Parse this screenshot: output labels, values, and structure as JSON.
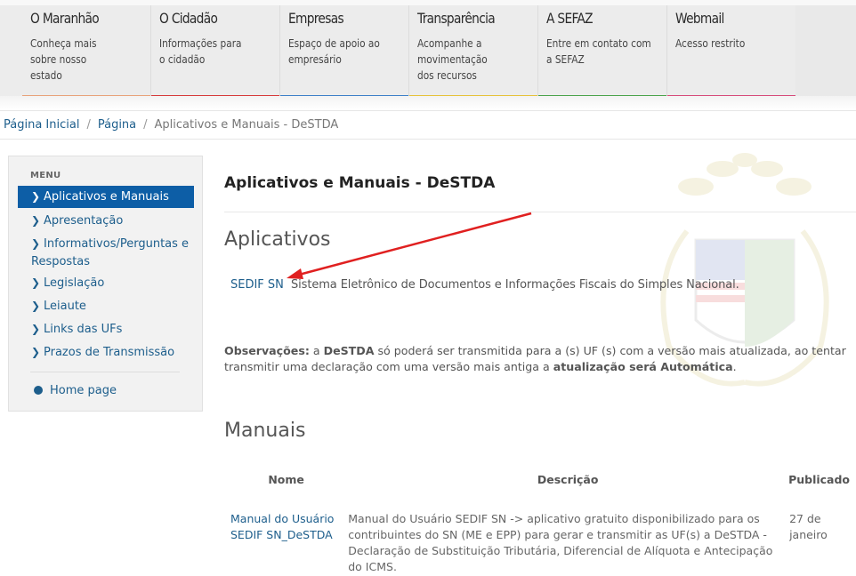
{
  "nav": [
    {
      "title": "O Maranhão",
      "desc": "Conheça mais sobre nosso estado",
      "color": "#e8a27a"
    },
    {
      "title": "O Cidadão",
      "desc": "Informações para o cidadão",
      "color": "#d63a3a"
    },
    {
      "title": "Empresas",
      "desc": "Espaço de apoio ao empresário",
      "color": "#3d7fc8"
    },
    {
      "title": "Transparência",
      "desc": "Acompanhe a movimentação dos recursos",
      "color": "#e6c23a"
    },
    {
      "title": "A SEFAZ",
      "desc": "Entre em contato com a SEFAZ",
      "color": "#4aa34a"
    },
    {
      "title": "Webmail",
      "desc": "Acesso restrito",
      "color": "#d64a7a"
    }
  ],
  "breadcrumb": {
    "home": "Página Inicial",
    "page": "Página",
    "current": "Aplicativos e Manuais - DeSTDA"
  },
  "sidebar": {
    "heading": "MENU",
    "items": [
      {
        "label": "Aplicativos e Manuais"
      },
      {
        "label": "Apresentação"
      },
      {
        "label": "Informativos/Perguntas e Respostas"
      },
      {
        "label": "Legislação"
      },
      {
        "label": "Leiaute"
      },
      {
        "label": "Links das UFs"
      },
      {
        "label": "Prazos de Transmissão"
      }
    ],
    "home": "Home page"
  },
  "content": {
    "title": "Aplicativos e Manuais - DeSTDA",
    "apps_heading": "Aplicativos",
    "app_link": "SEDIF SN",
    "app_desc": "Sistema Eletrônico de Documentos e Informações Fiscais do Simples Nacional.",
    "obs_label": "Observações:",
    "obs_a": " a ",
    "obs_destda": "DeSTDA",
    "obs_b": " só poderá ser transmitida para a (s) UF (s) com a versão mais atualizada, ao tentar transmitir uma declaração com uma versão mais antiga a ",
    "obs_bold": "atualização será Automática",
    "obs_end": ".",
    "manuals_heading": "Manuais",
    "table_headers": [
      "Nome",
      "Descrição",
      "Publicado"
    ],
    "rows": [
      {
        "name": "Manual do Usuário SEDIF SN_DeSTDA",
        "desc": "Manual do Usuário SEDIF SN -> aplicativo gratuito disponibilizado para os contribuintes do SN (ME e EPP) para gerar e transmitir as UF(s) a DeSTDA - Declaração de Substituição Tributária, Diferencial de Alíquota e Antecipação do ICMS.",
        "published": "27 de janeiro"
      }
    ]
  },
  "colors": {
    "accent": "#0d5ea6",
    "link": "#1d5e8c",
    "arrow": "#e02020"
  }
}
